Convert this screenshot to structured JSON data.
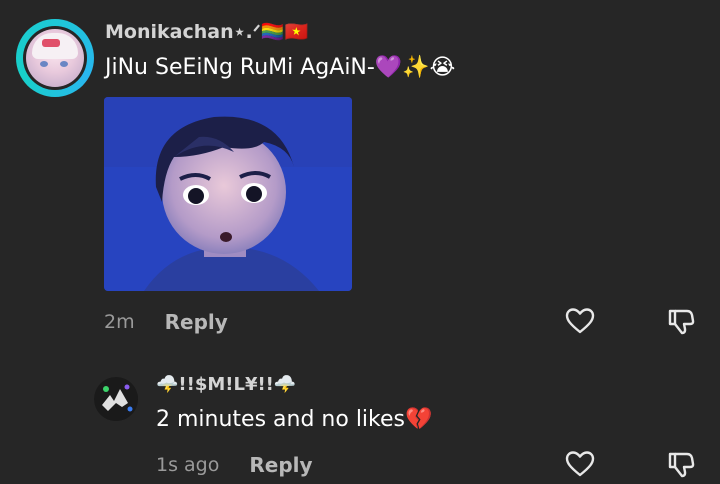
{
  "comment": {
    "username": "Monikachan⋆.ᐟ",
    "username_flags": "🏳️‍🌈🇻🇳",
    "text": "JiNu SeEiNg RuMi AgAiN-💜✨😭",
    "time": "2m",
    "reply_label": "Reply"
  },
  "reply": {
    "username": "🌩️!!$M!L¥!!🌩️",
    "text": "2 minutes and no likes💔",
    "time": "1s ago",
    "reply_label": "Reply"
  },
  "icons": {
    "like": "heart-outline-icon",
    "dislike": "thumbs-down-outline-icon"
  },
  "colors": {
    "background": "#262626",
    "avatar_ring": "#1ec8d6",
    "muted_text": "#9a9a9a"
  }
}
